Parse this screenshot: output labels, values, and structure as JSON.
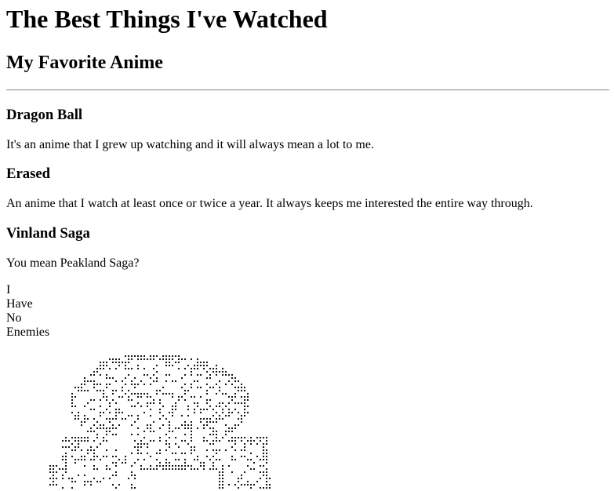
{
  "page": {
    "title": "The Best Things I've Watched",
    "subtitle": "My Favorite Anime"
  },
  "shows": [
    {
      "title": "Dragon Ball",
      "description": "It's an anime that I grew up watching and it will always mean a lot to me."
    },
    {
      "title": "Erased",
      "description": "An anime that I watch at least once or twice a year. It always keeps me interested the entire way through."
    },
    {
      "title": "Vinland Saga",
      "description": "You mean Peakland Saga?"
    }
  ],
  "quote_lines": [
    "I",
    "Have",
    "No",
    "Enemies"
  ],
  "art": {
    "icon": "braille-dot-art-figure",
    "color": "#000000"
  }
}
